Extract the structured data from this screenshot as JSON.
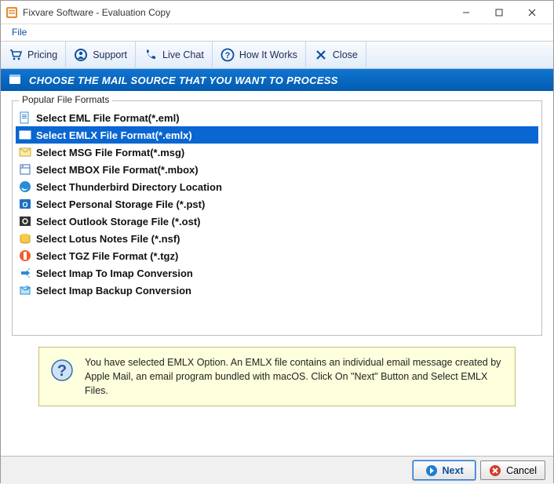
{
  "window": {
    "title": "Fixvare Software - Evaluation Copy"
  },
  "menu": {
    "file": "File"
  },
  "toolbar": {
    "pricing": "Pricing",
    "support": "Support",
    "livechat": "Live Chat",
    "how": "How It Works",
    "close": "Close"
  },
  "banner": {
    "text": "CHOOSE THE MAIL SOURCE THAT YOU WANT TO PROCESS"
  },
  "fieldset": {
    "legend": "Popular File Formats"
  },
  "items": [
    {
      "label": "Select EML File Format(*.eml)",
      "icon": "eml"
    },
    {
      "label": "Select EMLX File Format(*.emlx)",
      "icon": "emlx",
      "selected": true
    },
    {
      "label": "Select MSG File Format(*.msg)",
      "icon": "msg"
    },
    {
      "label": "Select MBOX File Format(*.mbox)",
      "icon": "mbox"
    },
    {
      "label": "Select Thunderbird Directory Location",
      "icon": "tbird"
    },
    {
      "label": "Select Personal Storage File (*.pst)",
      "icon": "pst"
    },
    {
      "label": "Select Outlook Storage File (*.ost)",
      "icon": "ost"
    },
    {
      "label": "Select Lotus Notes File (*.nsf)",
      "icon": "nsf"
    },
    {
      "label": "Select TGZ File Format (*.tgz)",
      "icon": "tgz"
    },
    {
      "label": "Select Imap To Imap Conversion",
      "icon": "imap"
    },
    {
      "label": "Select Imap Backup Conversion",
      "icon": "imapbk"
    }
  ],
  "info": {
    "text": "You have selected EMLX Option. An EMLX file contains an individual email message created by Apple Mail, an email program bundled with macOS. Click On \"Next\" Button and Select EMLX Files."
  },
  "footer": {
    "next": "Next",
    "cancel": "Cancel"
  }
}
